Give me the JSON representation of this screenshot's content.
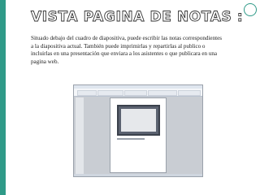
{
  "slide": {
    "title": "Vista pagina de notas :",
    "body": "Situado debajo del cuadro de diapositiva, puede escribir las notas correspondientes a la diapositiva actual. También  puede imprimirlas y repartirlas al publico o incluirlas en una presentación que enviara a los asistentes o que publicara en una pagina web."
  },
  "colors": {
    "accent": "#2f9a88",
    "title_fill": "#ffffff",
    "title_outline": "#333333",
    "body_text": "#222222"
  }
}
